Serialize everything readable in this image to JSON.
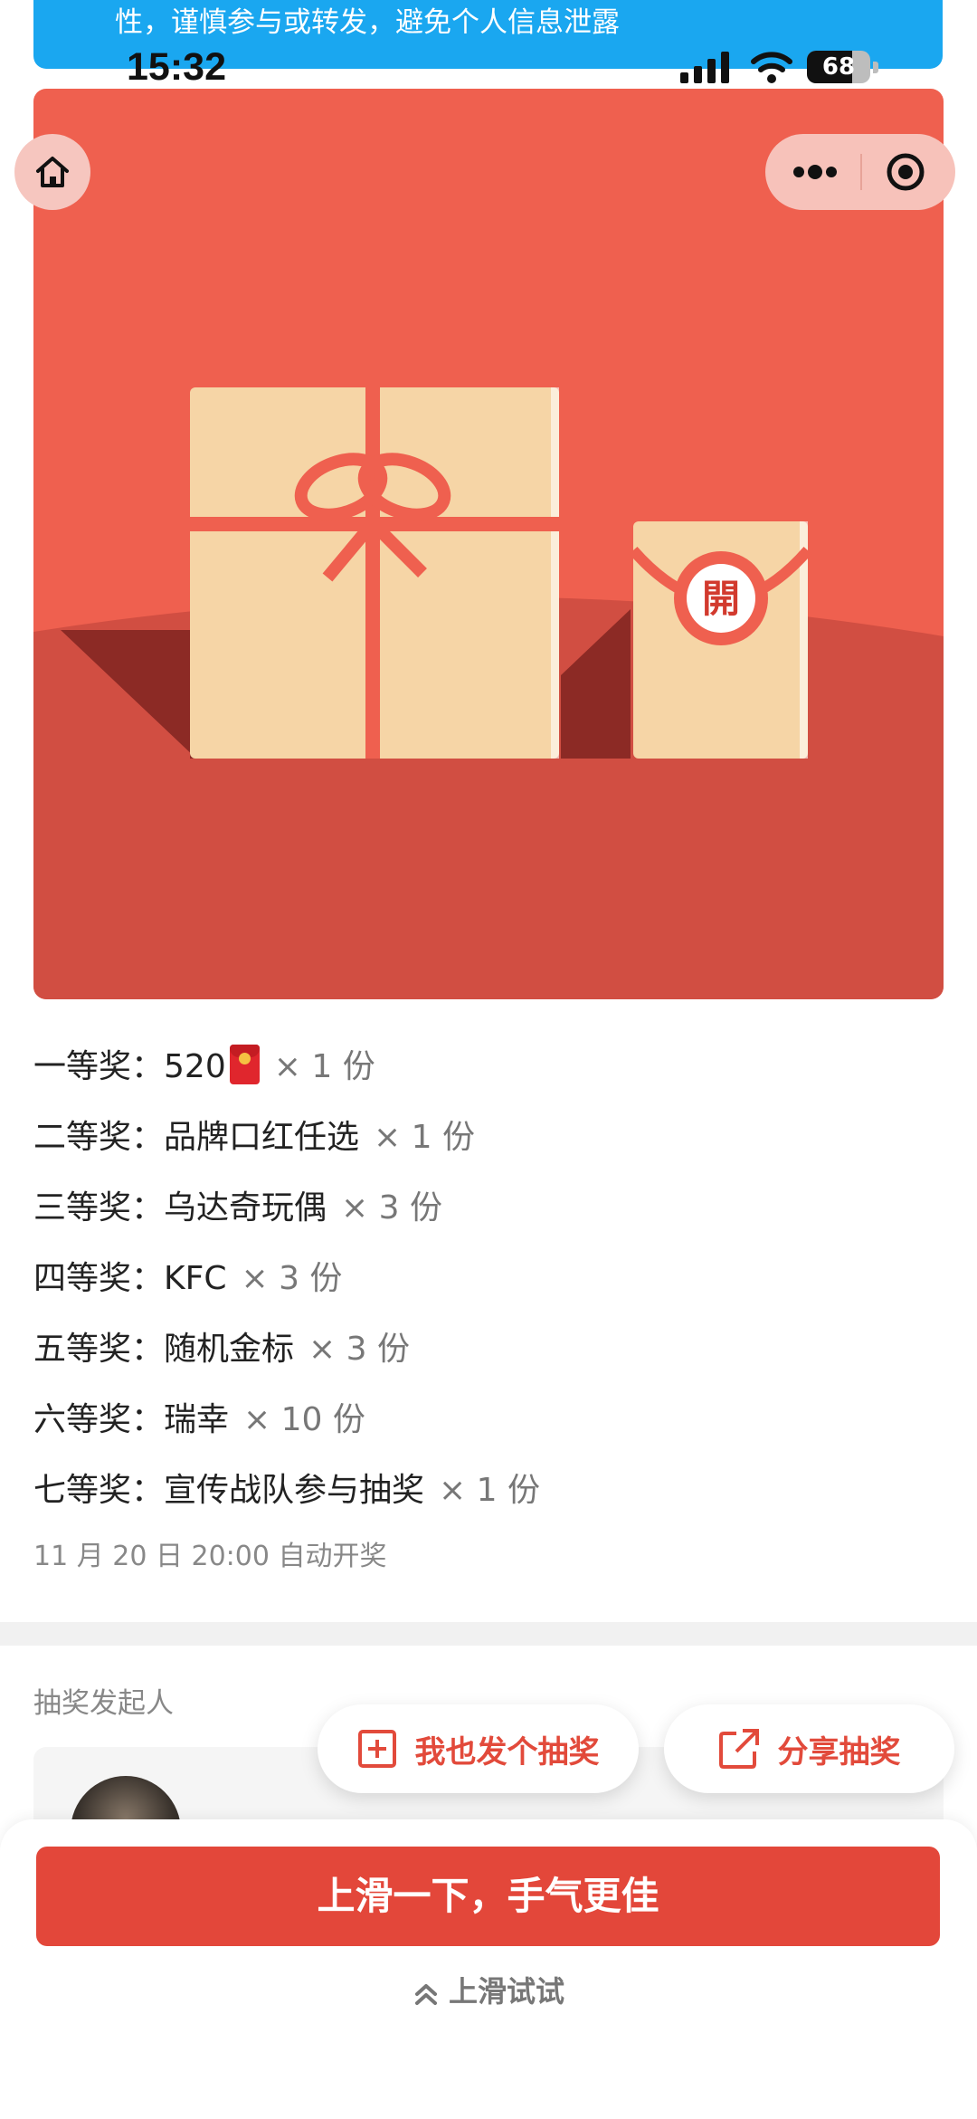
{
  "notice_banner": {
    "text": "性，谨慎参与或转发，避免个人信息泄露"
  },
  "status_bar": {
    "time": "15:32",
    "battery": "68"
  },
  "hero": {
    "envelope_seal": "開"
  },
  "prizes": [
    {
      "rank": "一等奖：",
      "name": "520",
      "has_redpacket": true,
      "qty": "× 1 份"
    },
    {
      "rank": "二等奖：",
      "name": "品牌口红任选",
      "qty": "× 1 份"
    },
    {
      "rank": "三等奖：",
      "name": "乌达奇玩偶",
      "qty": "× 3 份"
    },
    {
      "rank": "四等奖：",
      "name": "KFC",
      "qty": "× 3 份"
    },
    {
      "rank": "五等奖：",
      "name": "随机金标",
      "qty": "× 3 份"
    },
    {
      "rank": "六等奖：",
      "name": "瑞幸",
      "qty": "× 10 份"
    },
    {
      "rank": "七等奖：",
      "name": "宣传战队参与抽奖",
      "qty": "× 1 份"
    }
  ],
  "draw_time": "11 月 20 日 20:00 自动开奖",
  "organizer": {
    "label": "抽奖发起人"
  },
  "actions": {
    "create_lottery": "我也发个抽奖",
    "share_lottery": "分享抽奖"
  },
  "cta": {
    "main": "上滑一下，手气更佳",
    "hint": "上滑试试"
  },
  "colors": {
    "banner": "#1aa7f0",
    "hero_top": "#ef604f",
    "hero_bottom": "#d14e42",
    "gift": "#f6d5a6",
    "accent_red": "#e3473a"
  }
}
